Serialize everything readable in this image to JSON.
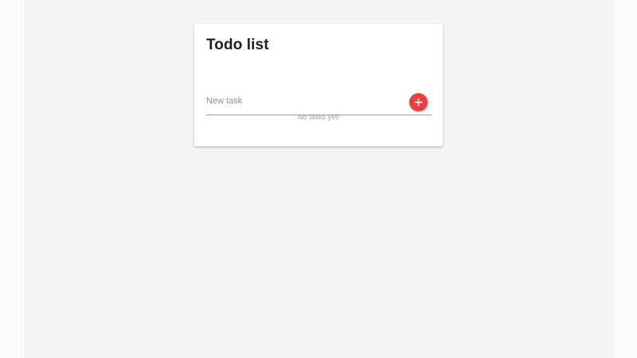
{
  "todo": {
    "title": "Todo list",
    "input": {
      "placeholder": "New task",
      "value": ""
    },
    "add_button": {
      "icon": "plus-icon",
      "color": "#ef3d3b"
    },
    "empty_message": "No tasks yet!"
  }
}
